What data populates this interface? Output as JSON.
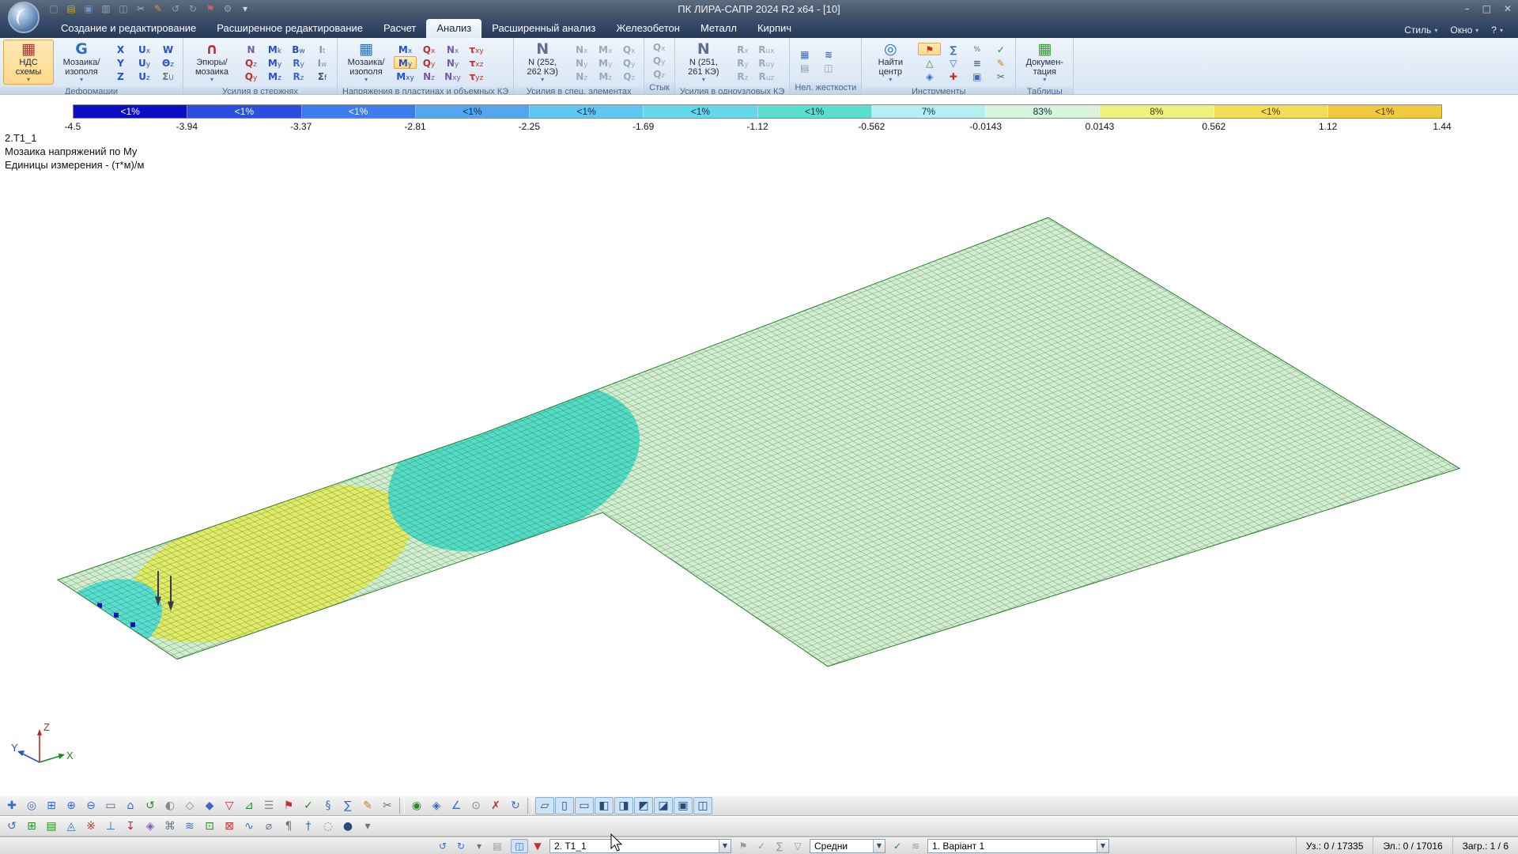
{
  "window": {
    "title": "ПК ЛИРА-САПР  2024 R2 x64 - [10]",
    "controls": {
      "minimize": "–",
      "maximize": "□",
      "close": "✕"
    }
  },
  "quick_access": {
    "items": [
      {
        "g": "□",
        "n": "new-file-icon",
        "c": "#8a97a6"
      },
      {
        "g": "▤",
        "n": "open-file-icon",
        "c": "#c8a030"
      },
      {
        "g": "▣",
        "n": "save-icon",
        "c": "#6f92c8"
      },
      {
        "g": "▥",
        "n": "print-icon",
        "c": "#93a2b2"
      },
      {
        "g": "◫",
        "n": "copy-icon",
        "c": "#93a2b2"
      },
      {
        "g": "✂",
        "n": "cut-icon",
        "c": "#a8b2be"
      },
      {
        "g": "✎",
        "n": "brush-icon",
        "c": "#cf9a4e"
      },
      {
        "g": "↺",
        "n": "undo-icon",
        "c": "#7fa2d0"
      },
      {
        "g": "↻",
        "n": "redo-icon",
        "c": "#7fa2d0"
      },
      {
        "g": "⚑",
        "n": "flag-icon",
        "c": "#c86060"
      },
      {
        "g": "⚙",
        "n": "settings-icon",
        "c": "#93a2b2"
      },
      {
        "g": "▾",
        "n": "customize-quick-access-icon",
        "c": "#cfd6de"
      }
    ]
  },
  "ribbon": {
    "tabs": [
      {
        "label": "Создание и редактирование"
      },
      {
        "label": "Расширенное редактирование"
      },
      {
        "label": "Расчет"
      },
      {
        "label": "Анализ",
        "sel": true
      },
      {
        "label": "Расширенный анализ"
      },
      {
        "label": "Железобетон"
      },
      {
        "label": "Металл"
      },
      {
        "label": "Кирпич"
      }
    ],
    "window_menu": [
      {
        "label": "Стиль"
      },
      {
        "label": "Окно"
      },
      {
        "label": "?"
      }
    ],
    "groups": [
      {
        "title": "Деформации",
        "big": [
          {
            "label": "НДС\nсхемы",
            "icon": "▦"
          },
          {
            "label": "Мозаика/\nизополя",
            "icon": "G"
          }
        ],
        "small": [
          {
            "t": "X",
            "c": "#2a50c8"
          },
          {
            "t": "Ux",
            "c": "#2a50c8"
          },
          {
            "t": "W",
            "c": "#2a50c8"
          },
          {
            "t": "Y",
            "c": "#2a50c8"
          },
          {
            "t": "Uy",
            "c": "#2a50c8"
          },
          {
            "t": "Θz",
            "c": "#2a50c8"
          },
          {
            "t": "Z",
            "c": "#2a50c8"
          },
          {
            "t": "Uz",
            "c": "#2a50c8"
          },
          {
            "t": "ΣU",
            "c": "#667788"
          }
        ]
      },
      {
        "title": "Усилия в стержнях",
        "big": [
          {
            "label": "Эпюры/\nмозаика",
            "icon": "∩"
          }
        ],
        "small": [
          {
            "t": "N",
            "c": "#7a5aa0"
          },
          {
            "t": "Mk",
            "c": "#2a50c8"
          },
          {
            "t": "Bw",
            "c": "#2a50c8"
          },
          {
            "t": "It",
            "c": "#8899aa"
          },
          {
            "t": "Qz",
            "c": "#c03030"
          },
          {
            "t": "My",
            "c": "#2a50c8"
          },
          {
            "t": "Ry",
            "c": "#3a6ac8"
          },
          {
            "t": "Iw",
            "c": "#8899aa"
          },
          {
            "t": "Qy",
            "c": "#c03030"
          },
          {
            "t": "Mz",
            "c": "#2a50c8"
          },
          {
            "t": "Rz",
            "c": "#3a6ac8"
          },
          {
            "t": "Σf",
            "c": "#445566"
          }
        ]
      },
      {
        "title": "Напряжения в пластинах и объемных КЭ",
        "big": [
          {
            "label": "Мозаика/\nизополя",
            "icon": "▦"
          }
        ],
        "small": [
          {
            "t": "Mx",
            "c": "#2a50c8"
          },
          {
            "t": "Qx",
            "c": "#c03030"
          },
          {
            "t": "Nx",
            "c": "#7a5aa0"
          },
          {
            "t": "τxy",
            "c": "#c03030"
          },
          {
            "t": "My",
            "c": "#2a50c8",
            "sel": true
          },
          {
            "t": "Qy",
            "c": "#c03030"
          },
          {
            "t": "Ny",
            "c": "#7a5aa0"
          },
          {
            "t": "τxz",
            "c": "#c03030"
          },
          {
            "t": "Mxy",
            "c": "#2a50c8"
          },
          {
            "t": "Nz",
            "c": "#7a5aa0"
          },
          {
            "t": "Nxy",
            "c": "#7a5aa0"
          },
          {
            "t": "τyz",
            "c": "#c03030"
          }
        ]
      },
      {
        "title": "Усилия в спец. элементах",
        "big": [
          {
            "label": "N (252,\n262 КЭ)",
            "icon": "N"
          }
        ],
        "small": [
          {
            "t": "Nx",
            "c": "#99aabb"
          },
          {
            "t": "Mx",
            "c": "#99aabb"
          },
          {
            "t": "Qx",
            "c": "#99aabb"
          },
          {
            "t": "Ny",
            "c": "#99aabb"
          },
          {
            "t": "My",
            "c": "#99aabb"
          },
          {
            "t": "Qy",
            "c": "#99aabb"
          },
          {
            "t": "Nz",
            "c": "#99aabb"
          },
          {
            "t": "Mz",
            "c": "#99aabb"
          },
          {
            "t": "Qz",
            "c": "#99aabb"
          }
        ]
      },
      {
        "title": "Стык",
        "small": [
          {
            "t": "Qx",
            "c": "#99aabb"
          },
          {
            "t": "Qy",
            "c": "#99aabb"
          },
          {
            "t": "Qz",
            "c": "#99aabb"
          }
        ]
      },
      {
        "title": "Усилия в одноузловых КЭ",
        "big": [
          {
            "label": "N (251,\n261 КЭ)",
            "icon": "N"
          }
        ],
        "small": [
          {
            "t": "Rx",
            "c": "#99aabb"
          },
          {
            "t": "Rux",
            "c": "#99aabb"
          },
          {
            "t": "Ry",
            "c": "#99aabb"
          },
          {
            "t": "Ruy",
            "c": "#99aabb"
          },
          {
            "t": "Rz",
            "c": "#99aabb"
          },
          {
            "t": "Ruz",
            "c": "#99aabb"
          }
        ]
      },
      {
        "title": "Нел. жесткости",
        "icons": [
          {
            "g": "▦",
            "n": "stiffness-mosaic-icon",
            "c": "#3a6ac8"
          },
          {
            "g": "≋",
            "n": "stiffness-isofields-icon",
            "c": "#3a6ac8"
          },
          {
            "g": "▤",
            "n": "stiffness-table-icon",
            "c": "#8899aa"
          },
          {
            "g": "◫",
            "n": "stiffness-diagram-icon",
            "c": "#8899aa"
          }
        ]
      },
      {
        "title": "Инструменты",
        "big": [
          {
            "label": "Найти\nцентр",
            "icon": "◎"
          }
        ],
        "icons": [
          {
            "g": "⚑",
            "n": "flag-show-icon",
            "c": "#c03030",
            "sel": true
          },
          {
            "g": "∑",
            "n": "sum-icon",
            "c": "#3a6ac8"
          },
          {
            "g": "%",
            "n": "percent-icon",
            "c": "#556677"
          },
          {
            "g": "✓",
            "n": "check-icon",
            "c": "#2a8a2a"
          },
          {
            "g": "△",
            "n": "local-axes-icon",
            "c": "#2a8a2a"
          },
          {
            "g": "▽",
            "n": "filter-icon",
            "c": "#3a6ac8"
          },
          {
            "g": "≡",
            "n": "values-list-icon",
            "c": "#556677"
          },
          {
            "g": "✎",
            "n": "annotate-icon",
            "c": "#c08030"
          },
          {
            "g": "◈",
            "n": "isofields-icon",
            "c": "#3a6ac8"
          },
          {
            "g": "✚",
            "n": "add-icon",
            "c": "#c03030"
          },
          {
            "g": "▣",
            "n": "fragment-icon",
            "c": "#3a6ac8"
          },
          {
            "g": "✂",
            "n": "section-cut-icon",
            "c": "#556677"
          }
        ]
      },
      {
        "title": "Таблицы",
        "big": [
          {
            "label": "Докумен-\nтация",
            "icon": "▦"
          }
        ]
      }
    ]
  },
  "scale_bar": {
    "segments": [
      {
        "label": "<1%",
        "bg": "#0d0dc6",
        "fg": "#ffffff"
      },
      {
        "label": "<1%",
        "bg": "#2a4fe0",
        "fg": "#ffffff"
      },
      {
        "label": "<1%",
        "bg": "#3c7cec",
        "fg": "#ffffff"
      },
      {
        "label": "<1%",
        "bg": "#54a6f0",
        "fg": "#0e2b46"
      },
      {
        "label": "<1%",
        "bg": "#60c6f2",
        "fg": "#0e2b46"
      },
      {
        "label": "<1%",
        "bg": "#62d8ea",
        "fg": "#0e2b46"
      },
      {
        "label": "<1%",
        "bg": "#5adfcd",
        "fg": "#0e2b46"
      },
      {
        "label": "7%",
        "bg": "#b4eff2",
        "fg": "#0e2b46"
      },
      {
        "label": "83%",
        "bg": "#d9f3dc",
        "fg": "#0e2b46"
      },
      {
        "label": "8%",
        "bg": "#eff17c",
        "fg": "#4a3a0e"
      },
      {
        "label": "<1%",
        "bg": "#f2de55",
        "fg": "#4a3a0e"
      },
      {
        "label": "<1%",
        "bg": "#f2c83e",
        "fg": "#4a3a0e"
      }
    ],
    "boundaries": [
      "-4.5",
      "-3.94",
      "-3.37",
      "-2.81",
      "-2.25",
      "-1.69",
      "-1.12",
      "-0.562",
      "-0.0143",
      "0.0143",
      "0.562",
      "1.12",
      "1.44"
    ]
  },
  "info": {
    "line1": "2.Т1_1",
    "line2": "Мозаика напряжений по My",
    "line3": "Единицы измерения - (т*м)/м"
  },
  "mesh": {
    "plate": "#d2edcf",
    "teal": "#55dcc9",
    "yellow": "#e3ea66",
    "tip_teal": "#59ddd2",
    "dots": "#0d0dc6"
  },
  "axes": {
    "x": "X",
    "y": "Y",
    "z": "Z",
    "x_color": "#1a8a1a",
    "y_color": "#2a50c8",
    "z_color": "#d02020"
  },
  "toolbar_view": {
    "items": [
      {
        "g": "✚",
        "n": "pan-icon",
        "c": "#3a6ac8"
      },
      {
        "g": "◎",
        "n": "zoom-dynamic-icon",
        "c": "#3a6ac8"
      },
      {
        "g": "⊞",
        "n": "zoom-window-icon",
        "c": "#3a6ac8"
      },
      {
        "g": "⊕",
        "n": "zoom-in-icon",
        "c": "#3a6ac8"
      },
      {
        "g": "⊖",
        "n": "zoom-out-icon",
        "c": "#3a6ac8"
      },
      {
        "g": "▭",
        "n": "fit-screen-icon",
        "c": "#3a6ac8"
      },
      {
        "g": "⌂",
        "n": "initial-view-icon",
        "c": "#3a6ac8"
      },
      {
        "g": "↺",
        "n": "rotate-view-icon",
        "c": "#2a8a2a"
      },
      {
        "g": "◐",
        "n": "render-mode-icon",
        "c": "#888888"
      },
      {
        "g": "◇",
        "n": "wireframe-icon",
        "c": "#888888"
      },
      {
        "g": "◆",
        "n": "shaded-view-icon",
        "c": "#3a6ac8"
      },
      {
        "g": "▽",
        "n": "filter-icon",
        "c": "#c03030"
      },
      {
        "g": "⊿",
        "n": "local-axes-icon",
        "c": "#2a8a2a"
      },
      {
        "g": "☰",
        "n": "layers-icon",
        "c": "#888888"
      },
      {
        "g": "⚑",
        "n": "flags-icon",
        "c": "#c03030"
      },
      {
        "g": "✓",
        "n": "apply-icon",
        "c": "#2a8a2a"
      },
      {
        "g": "§",
        "n": "section-icon",
        "c": "#3a6ac8"
      },
      {
        "g": "∑",
        "n": "totals-icon",
        "c": "#3a6ac8"
      },
      {
        "g": "✎",
        "n": "edit-icon",
        "c": "#c08030"
      },
      {
        "g": "✂",
        "n": "cut-icon",
        "c": "#667788"
      },
      {
        "n": "toolbar-separator",
        "sep": true
      },
      {
        "g": "◉",
        "n": "select-nodes-icon",
        "c": "#2a8a2a"
      },
      {
        "g": "◈",
        "n": "select-elements-icon",
        "c": "#3a6ac8"
      },
      {
        "g": "∠",
        "n": "measure-icon",
        "c": "#3a6ac8"
      },
      {
        "g": "⊙",
        "n": "snap-icon",
        "c": "#888888"
      },
      {
        "g": "✗",
        "n": "deselect-icon",
        "c": "#c03030"
      },
      {
        "g": "↻",
        "n": "redo-view-icon",
        "c": "#3a6ac8"
      },
      {
        "n": "toolbar-separator",
        "sep": true
      },
      {
        "g": "▱",
        "n": "projection-xy-icon",
        "c": "#2a4a7a",
        "sel": true
      },
      {
        "g": "▯",
        "n": "projection-xz-icon",
        "c": "#2a4a7a",
        "sel": true
      },
      {
        "g": "▭",
        "n": "projection-yz-icon",
        "c": "#2a4a7a",
        "sel": true
      },
      {
        "g": "◧",
        "n": "clip-left-icon",
        "c": "#2a4a7a",
        "sel": true
      },
      {
        "g": "◨",
        "n": "clip-right-icon",
        "c": "#2a4a7a",
        "sel": true
      },
      {
        "g": "◩",
        "n": "clip-top-icon",
        "c": "#2a4a7a",
        "sel": true
      },
      {
        "g": "◪",
        "n": "clip-bottom-icon",
        "c": "#2a4a7a",
        "sel": true
      },
      {
        "g": "▣",
        "n": "isometry-icon",
        "c": "#2a4a7a",
        "sel": true
      },
      {
        "g": "◫",
        "n": "dimetry-icon",
        "c": "#2a4a7a",
        "sel": true
      }
    ]
  },
  "toolbar_edit": {
    "items": [
      {
        "g": "↺",
        "n": "undo-icon",
        "c": "#3a6ac8"
      },
      {
        "g": "⊞",
        "n": "add-node-icon",
        "c": "#2a8a2a"
      },
      {
        "g": "▤",
        "n": "table-edit-icon",
        "c": "#2a8a2a"
      },
      {
        "g": "◬",
        "n": "triangulate-icon",
        "c": "#3a6ac8"
      },
      {
        "g": "※",
        "n": "show-nodes-icon",
        "c": "#c03030"
      },
      {
        "g": "⊥",
        "n": "supports-icon",
        "c": "#3a6ac8"
      },
      {
        "g": "↧",
        "n": "loads-icon",
        "c": "#c03030"
      },
      {
        "g": "◈",
        "n": "fragment-icon",
        "c": "#8a5ac0"
      },
      {
        "g": "⌘",
        "n": "groups-icon",
        "c": "#667788"
      },
      {
        "g": "≋",
        "n": "smooth-mesh-icon",
        "c": "#3a6ac8"
      },
      {
        "g": "⊡",
        "n": "plate-icon",
        "c": "#2a8a2a"
      },
      {
        "g": "⊠",
        "n": "delete-icon",
        "c": "#c03030"
      },
      {
        "g": "∿",
        "n": "spline-icon",
        "c": "#3a6ac8"
      },
      {
        "g": "⌀",
        "n": "diameter-icon",
        "c": "#667788"
      },
      {
        "g": "¶",
        "n": "notes-icon",
        "c": "#667788"
      },
      {
        "g": "†",
        "n": "marker-icon",
        "c": "#3a6ac8"
      },
      {
        "g": "◌",
        "n": "ghost-view-icon",
        "c": "#888888"
      },
      {
        "g": "●",
        "n": "point-icon",
        "c": "#2a4a7a"
      },
      {
        "g": "▾",
        "n": "toolbar-overflow-icon",
        "c": "#667788"
      }
    ]
  },
  "status_bar": {
    "history_icons": [
      {
        "g": "↺",
        "n": "result-back-icon",
        "c": "#3a6ac8"
      },
      {
        "g": "↻",
        "n": "result-forward-icon",
        "c": "#3a6ac8"
      },
      {
        "g": "▾",
        "n": "result-list-icon",
        "c": "#667788"
      },
      {
        "g": "▤",
        "n": "result-table-icon",
        "c": "#999999"
      }
    ],
    "mosaic_icons": [
      {
        "g": "◫",
        "n": "mosaic-type-icon",
        "c": "#3a6ac8",
        "sel": true
      },
      {
        "g": "▼",
        "n": "mosaic-dropdown-icon",
        "c": "#c03030"
      }
    ],
    "mosaic_combo": "2. Т1_1",
    "value_icons": [
      {
        "g": "⚑",
        "n": "show-values-icon",
        "c": "#999999"
      },
      {
        "g": "✓",
        "n": "apply-mosaic-icon",
        "c": "#999999"
      },
      {
        "g": "∑",
        "n": "sum-values-icon",
        "c": "#999999"
      },
      {
        "g": "▽",
        "n": "filter-values-icon",
        "c": "#999999"
      }
    ],
    "averaging_combo": "Средни",
    "apply_icons": [
      {
        "g": "✓",
        "n": "apply-averaging-icon",
        "c": "#2a8a2a"
      },
      {
        "g": "≋",
        "n": "smoothing-icon",
        "c": "#999999"
      }
    ],
    "loadcase_combo": "1. Варіант 1",
    "nodes": "Уз.: 0 / 17335",
    "elements": "Эл.: 0 / 17016",
    "loads": "Загр.: 1 / 6"
  }
}
